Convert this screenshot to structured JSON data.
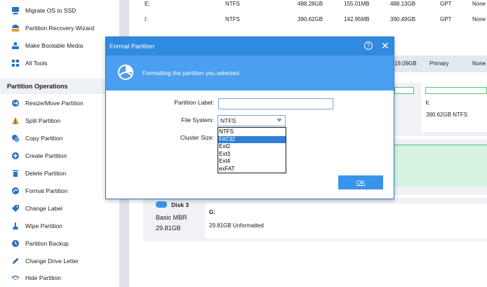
{
  "sidebar": {
    "top_items": [
      {
        "label": "Migrate OS to SSD",
        "icon": "migrate-os-icon"
      },
      {
        "label": "Partition Recovery Wizard",
        "icon": "recovery-icon"
      },
      {
        "label": "Make Bootable Media",
        "icon": "bootable-media-icon"
      },
      {
        "label": "All Tools",
        "icon": "all-tools-icon"
      }
    ],
    "section_title": "Partition Operations",
    "ops": [
      {
        "label": "Resize/Move Partition",
        "icon": "resize-icon"
      },
      {
        "label": "Split Partition",
        "icon": "split-icon"
      },
      {
        "label": "Copy Partition",
        "icon": "copy-icon"
      },
      {
        "label": "Create Partition",
        "icon": "create-icon"
      },
      {
        "label": "Delete Partition",
        "icon": "trash-icon"
      },
      {
        "label": "Format Partition",
        "icon": "format-icon"
      },
      {
        "label": "Change Label",
        "icon": "tag-icon"
      },
      {
        "label": "Wipe Partition",
        "icon": "wipe-icon"
      },
      {
        "label": "Partition Backup",
        "icon": "backup-icon"
      },
      {
        "label": "Change Drive Letter",
        "icon": "pencil-icon"
      },
      {
        "label": "Hide Partition",
        "icon": "hide-icon"
      }
    ]
  },
  "partition_table": {
    "rows": [
      {
        "drive": "E:",
        "fs": "NTFS",
        "capacity": "488.28GB",
        "used": "155.01MB",
        "unused": "488.13GB",
        "type": "GPT",
        "status": "None"
      },
      {
        "drive": "I:",
        "fs": "NTFS",
        "capacity": "390.62GB",
        "used": "142.95MB",
        "unused": "390.49GB",
        "type": "GPT",
        "status": "None"
      }
    ],
    "partial_row": {
      "unused": "19.09GB",
      "type": "Primary",
      "status": "None"
    }
  },
  "disk_map": {
    "disk2_partition": {
      "letter": "I:",
      "detail": "390.62GB NTFS"
    },
    "disk3": {
      "name": "Disk 3",
      "type": "Basic MBR",
      "size": "29.81GB",
      "partition_letter": "G:",
      "partition_detail": "29.81GB Unformatted"
    }
  },
  "dialog": {
    "title": "Format Partition",
    "help_glyph": "?",
    "close_glyph": "✕",
    "banner_text": "Formatting the partition you selected.",
    "label_field": {
      "label": "Partition Label:",
      "value": ""
    },
    "fs_field": {
      "label": "File System:",
      "value": "NTFS"
    },
    "cluster_field": {
      "label": "Cluster Size:"
    },
    "fs_options": [
      "NTFS",
      "FAT32",
      "Ext2",
      "Ext3",
      "Ext4",
      "exFAT"
    ],
    "highlighted_option": "FAT32",
    "ok_label": "OK"
  },
  "colors": {
    "accent": "#2f8ae0",
    "banner": "#4a9ff0",
    "partition_green": "#52c47d"
  }
}
